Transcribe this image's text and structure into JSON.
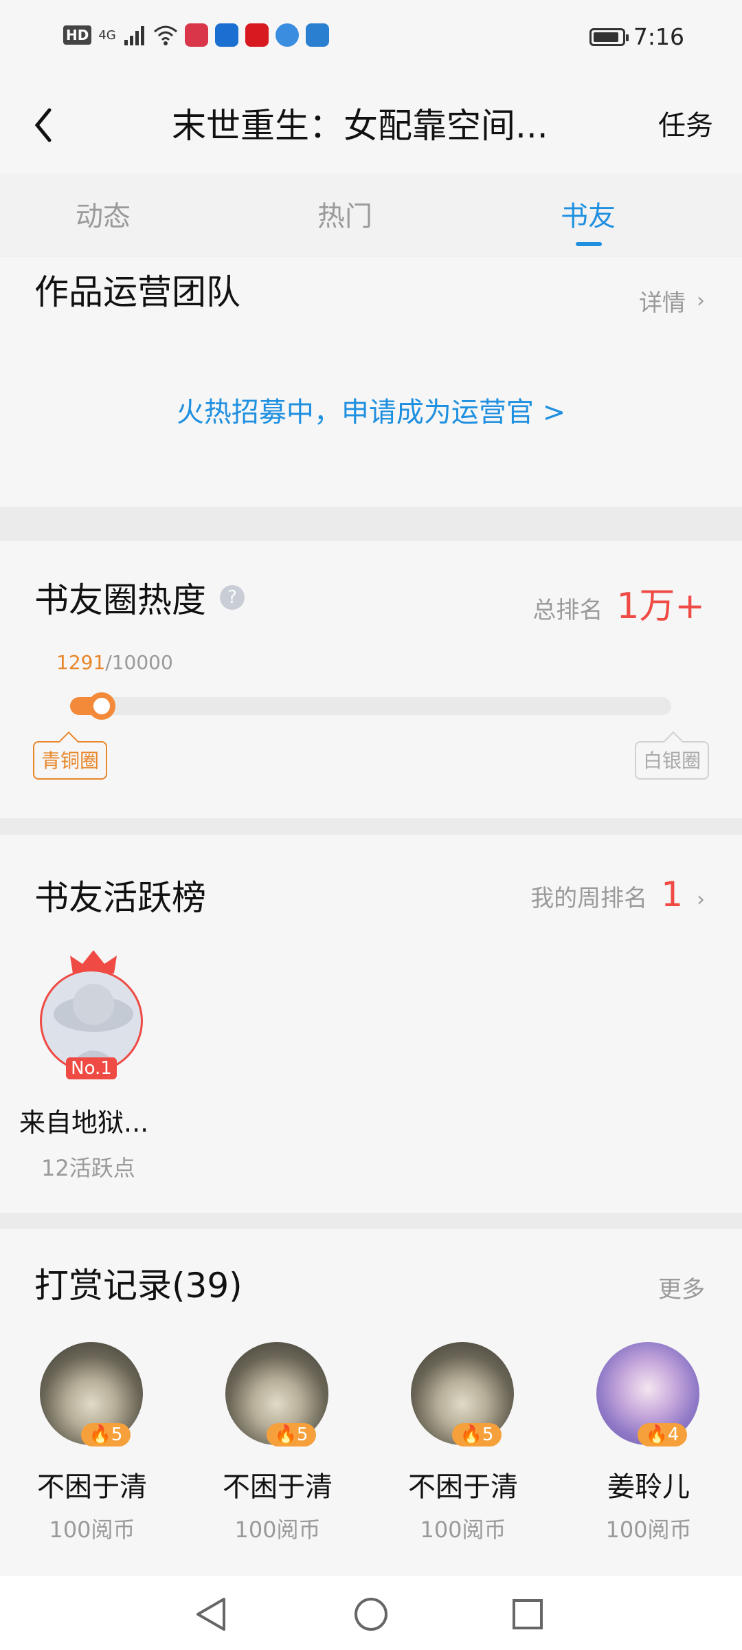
{
  "status_bar": {
    "badges": [
      "HD",
      "4G"
    ],
    "time": "7:16",
    "app_icon_colors": [
      "#d9364a",
      "#1b6fd1",
      "#d71920",
      "#3b8de0",
      "#2b7fd0"
    ]
  },
  "header": {
    "back_icon": "chevron-left-icon",
    "title": "末世重生：女配靠空间...",
    "task_label": "任务"
  },
  "tabs": [
    {
      "label": "动态",
      "active": false
    },
    {
      "label": "热门",
      "active": false
    },
    {
      "label": "书友",
      "active": true
    }
  ],
  "ops_team": {
    "heading": "作品运营团队",
    "detail_label": "详情",
    "recruit_text": "火热招募中，申请成为运营官 >"
  },
  "heat": {
    "heading": "书友圈热度",
    "rank_label": "总排名",
    "rank_value": "1万+",
    "current": "1291",
    "total": "/10000",
    "progress_fraction": 0.1291,
    "tier_current": "青铜圈",
    "tier_next": "白银圈",
    "accent_color": "#f28a3a"
  },
  "active_board": {
    "heading": "书友活跃榜",
    "my_rank_label": "我的周排名",
    "my_rank_value": "1",
    "top_user": {
      "badge": "No.1",
      "name": "来自地狱...",
      "points": "12活跃点"
    }
  },
  "rewards": {
    "heading": "打赏记录(39)",
    "more_label": "更多",
    "items": [
      {
        "name": "不困于清",
        "level": "5",
        "amount": "100阅币",
        "avatar": "photo"
      },
      {
        "name": "不困于清",
        "level": "5",
        "amount": "100阅币",
        "avatar": "photo"
      },
      {
        "name": "不困于清",
        "level": "5",
        "amount": "100阅币",
        "avatar": "photo"
      },
      {
        "name": "姜聆儿",
        "level": "4",
        "amount": "100阅币",
        "avatar": "anime"
      }
    ]
  },
  "nav": {
    "back_icon": "triangle-back-icon",
    "home_icon": "circle-home-icon",
    "recent_icon": "square-recent-icon"
  }
}
